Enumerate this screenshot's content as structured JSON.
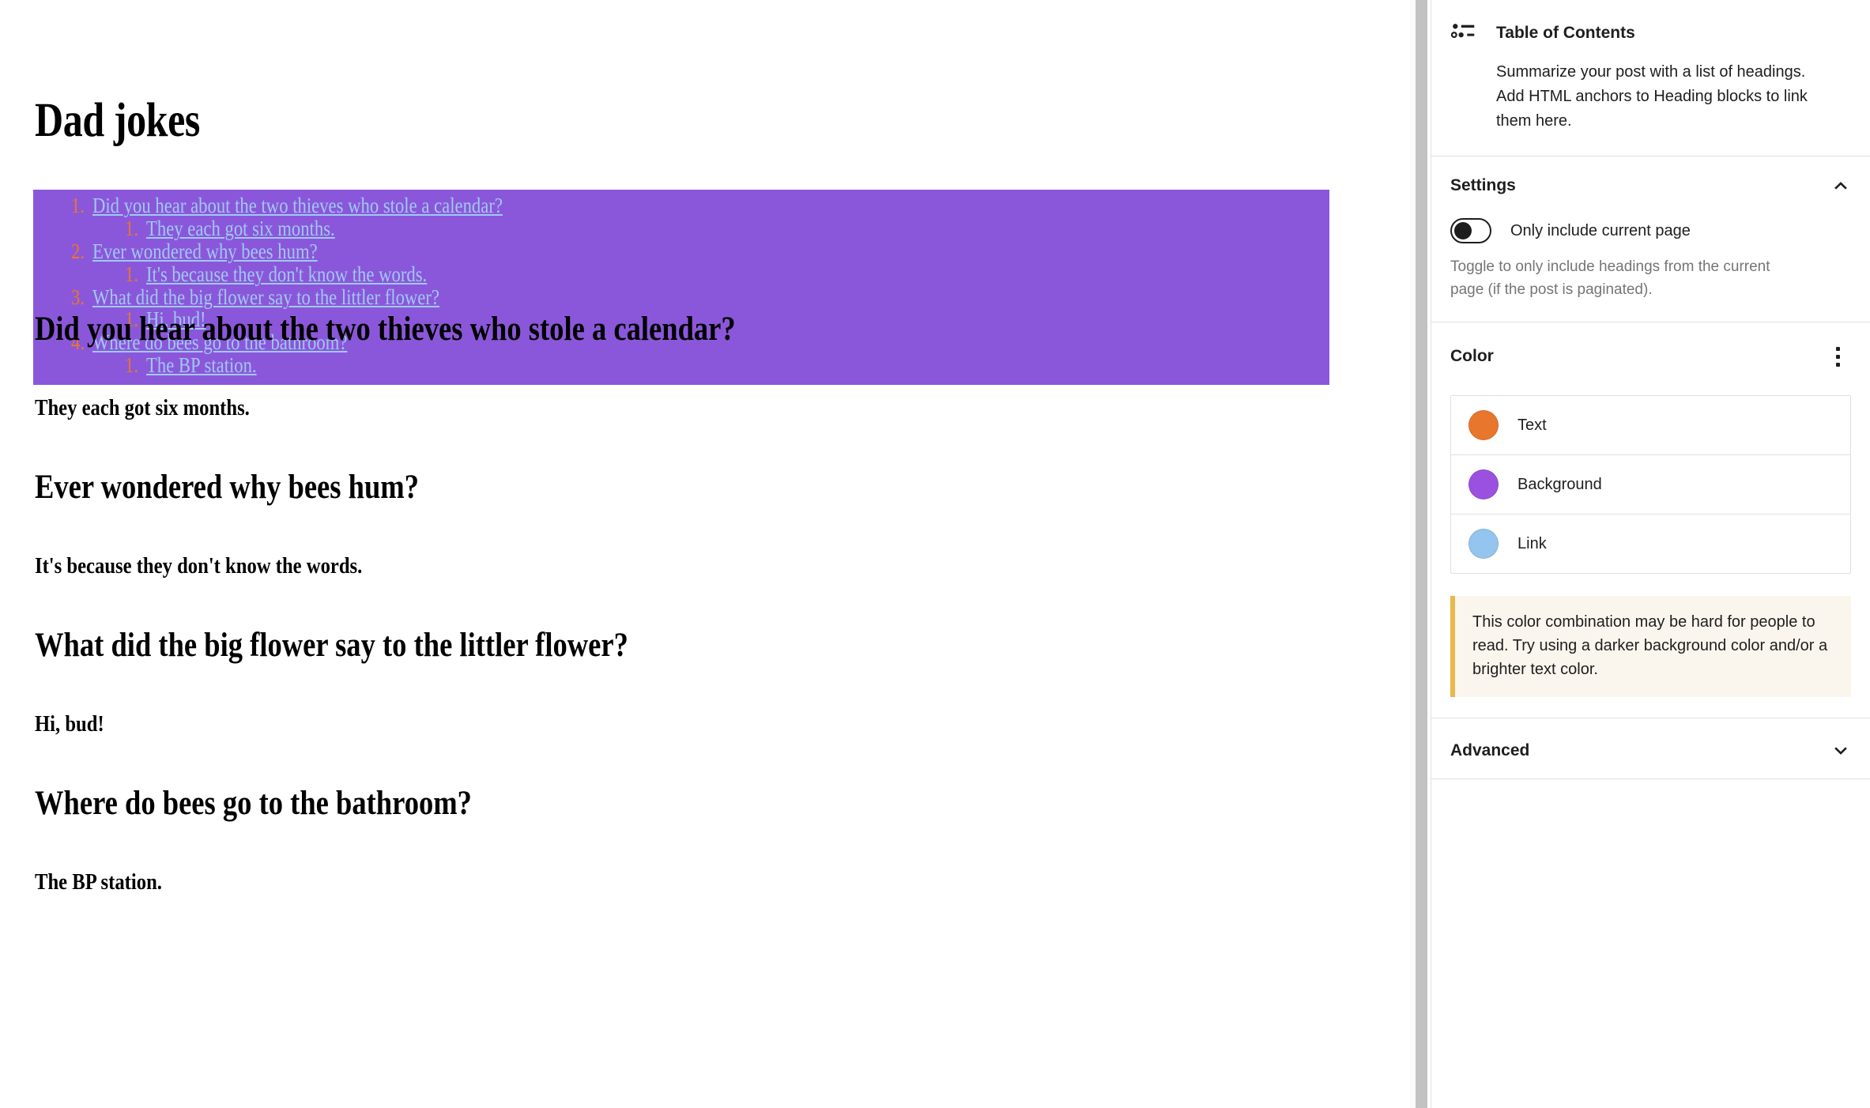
{
  "editor": {
    "post_title": "Dad jokes",
    "toc_block": {
      "background_color": "#8b57da",
      "number_color": "#e8762c",
      "link_color": "#9ec9f2",
      "entries": [
        {
          "number": "1.",
          "label": "Did you hear about the two thieves who stole a calendar?",
          "children": [
            {
              "number": "1.",
              "label": "They each got six months."
            }
          ]
        },
        {
          "number": "2.",
          "label": "Ever wondered why bees hum?",
          "children": [
            {
              "number": "1.",
              "label": "It's because they don't know the words."
            }
          ]
        },
        {
          "number": "3.",
          "label": "What did the big flower say to the littler flower?",
          "children": [
            {
              "number": "1.",
              "label": "Hi, bud!"
            }
          ]
        },
        {
          "number": "4.",
          "label": "Where do bees go to the bathroom?",
          "children": [
            {
              "number": "1.",
              "label": "The BP station."
            }
          ]
        }
      ]
    },
    "body": [
      {
        "type": "heading",
        "text": "Did you hear about the two thieves who stole a calendar?"
      },
      {
        "type": "paragraph",
        "text": "They each got six months."
      },
      {
        "type": "heading",
        "text": "Ever wondered why bees hum?"
      },
      {
        "type": "paragraph",
        "text": "It's because they don't know the words."
      },
      {
        "type": "heading",
        "text": "What did the big flower say to the littler flower?"
      },
      {
        "type": "paragraph",
        "text": "Hi, bud!"
      },
      {
        "type": "heading",
        "text": "Where do bees go to the bathroom?"
      },
      {
        "type": "paragraph",
        "text": "The BP station."
      }
    ]
  },
  "sidebar": {
    "block_card": {
      "icon": "table-of-contents-icon",
      "title": "Table of Contents",
      "description": "Summarize your post with a list of headings. Add HTML anchors to Heading blocks to link them here."
    },
    "settings": {
      "title": "Settings",
      "collapse_icon": "chevron-up-icon",
      "toggle": {
        "label": "Only include current page",
        "state": "off"
      },
      "help_text": "Toggle to only include headings from the current page (if the post is paginated)."
    },
    "color": {
      "title": "Color",
      "menu_icon": "kebab-menu-icon",
      "rows": [
        {
          "label": "Text",
          "value": "#e8762c"
        },
        {
          "label": "Background",
          "value": "#9b51e0"
        },
        {
          "label": "Link",
          "value": "#93c5ee"
        }
      ],
      "notice": "This color combination may be hard for people to read. Try using a darker background color and/or a brighter text color."
    },
    "advanced": {
      "title": "Advanced",
      "collapse_icon": "chevron-down-icon"
    }
  }
}
